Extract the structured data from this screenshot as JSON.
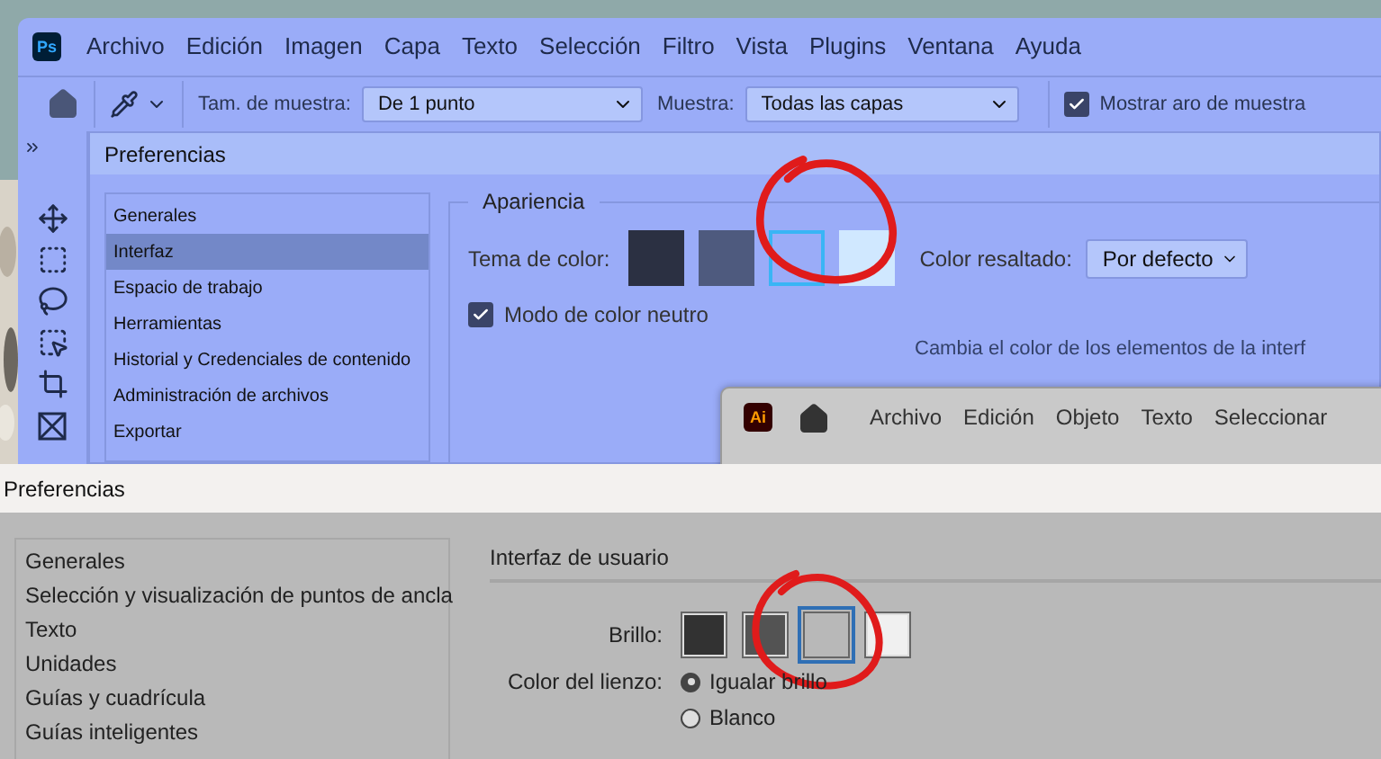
{
  "photoshop": {
    "app_icon": "Ps",
    "menu": [
      "Archivo",
      "Edición",
      "Imagen",
      "Capa",
      "Texto",
      "Selección",
      "Filtro",
      "Vista",
      "Plugins",
      "Ventana",
      "Ayuda"
    ],
    "options_bar": {
      "sample_size_label": "Tam. de muestra:",
      "sample_size": "De 1 punto",
      "sample_label": "Muestra:",
      "sample": "Todas las capas",
      "show_ring": {
        "label": "Mostrar aro de muestra",
        "checked": true
      }
    },
    "preferences": {
      "title": "Preferencias",
      "categories": [
        {
          "label": "Generales",
          "selected": false
        },
        {
          "label": "Interfaz",
          "selected": true
        },
        {
          "label": "Espacio de trabajo",
          "selected": false
        },
        {
          "label": "Herramientas",
          "selected": false
        },
        {
          "label": "Historial y Credenciales de contenido",
          "selected": false
        },
        {
          "label": "Administración de archivos",
          "selected": false
        },
        {
          "label": "Exportar",
          "selected": false
        }
      ],
      "appearance": {
        "legend": "Apariencia",
        "theme_label": "Tema de color:",
        "themes": [
          {
            "color": "#2b3042",
            "selected": false
          },
          {
            "color": "#4e5a7e",
            "selected": false
          },
          {
            "color": "#9aacf8",
            "selected": true
          },
          {
            "color": "#d0e8ff",
            "selected": false
          }
        ],
        "highlight_label": "Color resaltado:",
        "highlight": "Por defecto",
        "neutral_mode": {
          "label": "Modo de color neutro",
          "checked": true
        },
        "hint": "Cambia el color de los elementos de la interf"
      }
    }
  },
  "illustrator": {
    "app_icon": "Ai",
    "menu": [
      "Archivo",
      "Edición",
      "Objeto",
      "Texto",
      "Seleccionar"
    ]
  },
  "illustrator_preferences": {
    "title": "Preferencias",
    "categories": [
      {
        "label": "Generales",
        "selected": false
      },
      {
        "label": "Selección y visualización de puntos de ancla",
        "selected": false
      },
      {
        "label": "Texto",
        "selected": false
      },
      {
        "label": "Unidades",
        "selected": false
      },
      {
        "label": "Guías y cuadrícula",
        "selected": false
      },
      {
        "label": "Guías inteligentes",
        "selected": false
      }
    ],
    "section": "Interfaz de usuario",
    "brightness_label": "Brillo:",
    "brightness": [
      {
        "color": "#323232",
        "selected": false
      },
      {
        "color": "#535353",
        "selected": false
      },
      {
        "color": "#b8b8b8",
        "selected": true
      },
      {
        "color": "#f0f0f0",
        "selected": false
      }
    ],
    "canvas_label": "Color del lienzo:",
    "canvas_options": [
      {
        "label": "Igualar brillo",
        "selected": true
      },
      {
        "label": "Blanco",
        "selected": false
      }
    ]
  }
}
